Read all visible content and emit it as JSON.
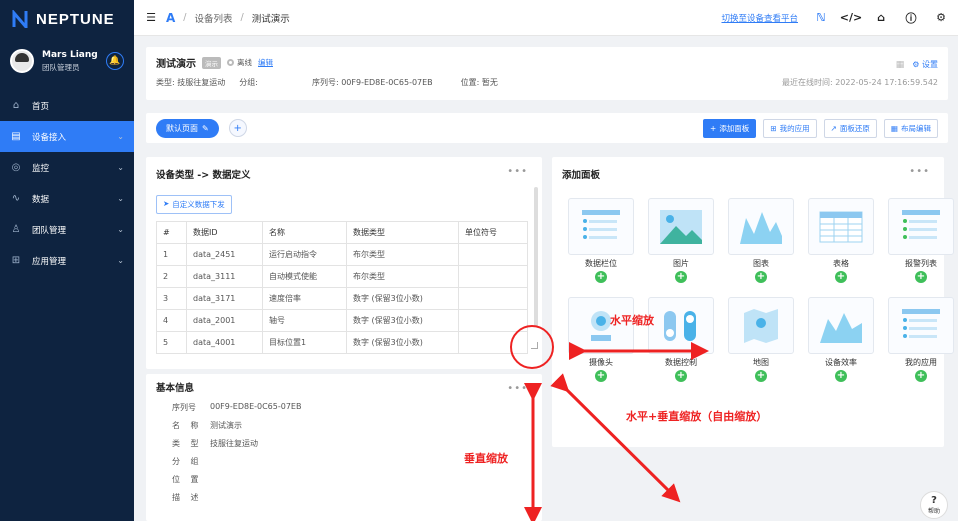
{
  "brand": {
    "name": "NEPTUNE",
    "color": "#2f7cf6"
  },
  "user": {
    "name": "Mars Liang",
    "role": "团队管理员"
  },
  "menu": [
    {
      "icon": "home-icon",
      "label": "首页",
      "active": false
    },
    {
      "icon": "device-access-icon",
      "label": "设备接入",
      "active": true
    },
    {
      "icon": "monitor-icon",
      "label": "监控",
      "active": false
    },
    {
      "icon": "data-icon",
      "label": "数据",
      "active": false
    },
    {
      "icon": "team-icon",
      "label": "团队管理",
      "active": false
    },
    {
      "icon": "apps-icon",
      "label": "应用管理",
      "active": false
    }
  ],
  "breadcrumb": {
    "list": "设备列表",
    "current": "测试演示"
  },
  "topbar": {
    "switch_link": "切换至设备查看平台"
  },
  "device": {
    "name": "测试演示",
    "tag": "演示",
    "status": "离线",
    "edit": "编辑",
    "settings": "设置",
    "type_label": "类型:",
    "type_value": "技服往复运动",
    "group_label": "分组:",
    "group_value": "",
    "serial_label": "序列号:",
    "serial_value": "00F9-ED8E-0C65-07EB",
    "location_label": "位置:",
    "location_value": "暂无",
    "last_online": "最近在线时间: 2022-05-24 17:16:59.542"
  },
  "tabs": {
    "default_page": "默认页面",
    "add_panel": "添加面板",
    "my_apps": "我的应用",
    "restore": "面板还原",
    "layout_edit": "布局编辑"
  },
  "def_panel": {
    "title": "设备类型 -> 数据定义",
    "download": "自定义数据下发",
    "headers": [
      "#",
      "数据ID",
      "名称",
      "数据类型",
      "单位符号"
    ],
    "rows": [
      [
        "1",
        "data_2451",
        "运行启动指令",
        "布尔类型",
        ""
      ],
      [
        "2",
        "data_3111",
        "自动模式使能",
        "布尔类型",
        ""
      ],
      [
        "3",
        "data_3171",
        "速度倍率",
        "数字 (保留3位小数)",
        ""
      ],
      [
        "4",
        "data_2001",
        "轴号",
        "数字 (保留3位小数)",
        ""
      ],
      [
        "5",
        "data_4001",
        "目标位置1",
        "数字 (保留3位小数)",
        ""
      ]
    ]
  },
  "basic_panel": {
    "title": "基本信息",
    "items": [
      {
        "k": "序列号",
        "v": "00F9-ED8E-0C65-07EB"
      },
      {
        "k": "名 称",
        "v": "测试演示"
      },
      {
        "k": "类 型",
        "v": "技服往复运动"
      },
      {
        "k": "分 组",
        "v": ""
      },
      {
        "k": "位 置",
        "v": ""
      },
      {
        "k": "描 述",
        "v": ""
      }
    ]
  },
  "add_panel": {
    "title": "添加面板",
    "tiles": [
      "数据栏位",
      "图片",
      "图表",
      "表格",
      "报警列表",
      "摄像头",
      "数据控制",
      "地图",
      "设备效率",
      "我的应用"
    ]
  },
  "annotations": {
    "horizontal": "水平缩放",
    "vertical": "垂直缩放",
    "free": "水平+垂直缩放（自由缩放）"
  },
  "help": {
    "label": "帮助"
  }
}
